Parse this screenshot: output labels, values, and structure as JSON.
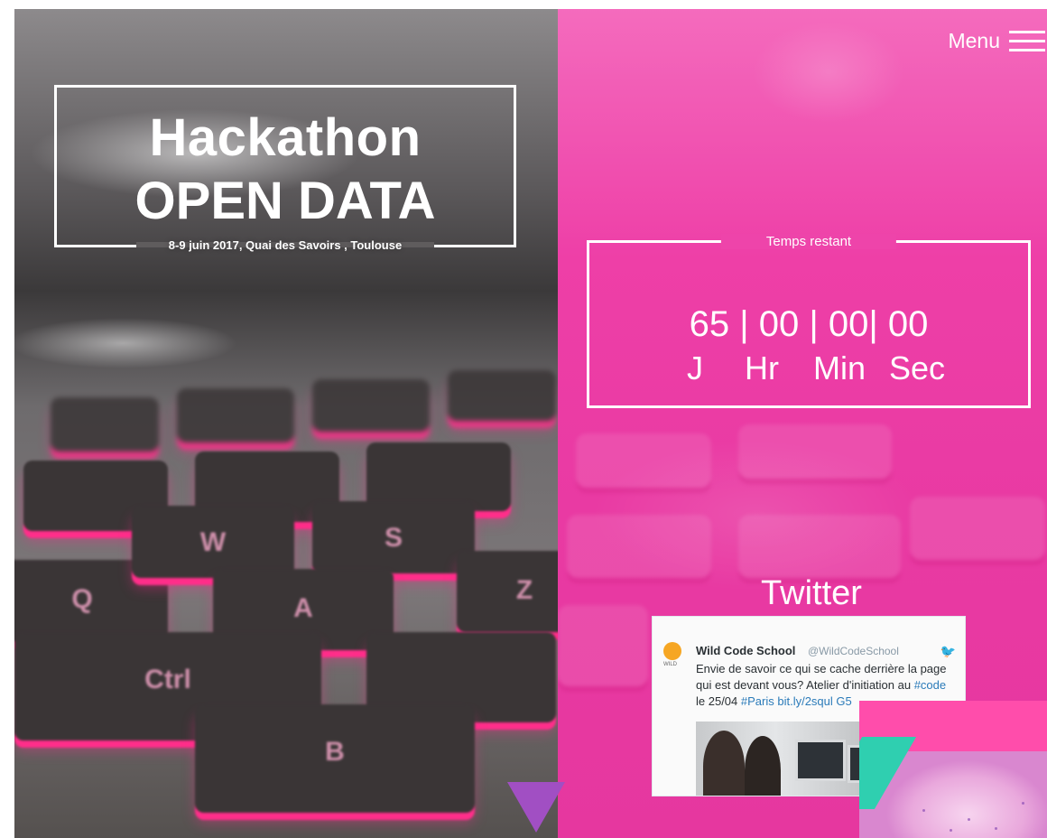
{
  "header": {
    "title_line1": "Hackathon",
    "title_line2": "OPEN DATA",
    "subtitle": "8-9 juin 2017, Quai des Savoirs ,  Toulouse",
    "menu_label": "Menu",
    "menu_icon": "hamburger-icon"
  },
  "countdown": {
    "label": "Temps restant",
    "values": "65 | 00 | 00| 00",
    "units": {
      "days": "J",
      "hours": "Hr",
      "minutes": "Min",
      "seconds": "Sec"
    }
  },
  "twitter": {
    "heading": "Twitter",
    "tweet": {
      "author_name": "Wild Code School",
      "author_handle": "@WildCodeSchool",
      "avatar_caption": "WILD",
      "text_part1": "Envie de savoir ce qui se cache derrière la page qui est devant vous? Atelier d'initiation au ",
      "link_code": "#code",
      "text_part2": " le 25/04 ",
      "link_paris": "#Paris",
      "link_url": " bit.ly/2squl G5"
    }
  },
  "colors": {
    "accent_pink": "#ee3fa7",
    "arrow_purple": "#a14fc3",
    "white": "#ffffff"
  },
  "icons": {
    "scroll_down": "triangle-down-icon",
    "twitter_bird": "twitter-bird-icon"
  }
}
